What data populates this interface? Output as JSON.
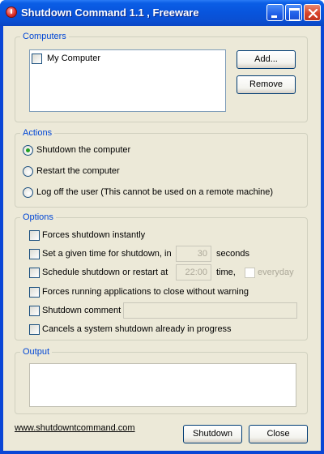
{
  "window": {
    "title": "Shutdown Command 1.1 , Freeware",
    "icon": "power-icon"
  },
  "computers": {
    "legend": "Computers",
    "items": [
      {
        "label": "My Computer",
        "checked": false
      }
    ],
    "add_label": "Add...",
    "remove_label": "Remove"
  },
  "actions": {
    "legend": "Actions",
    "options": [
      {
        "label": "Shutdown the computer",
        "checked": true
      },
      {
        "label": "Restart the computer",
        "checked": false
      },
      {
        "label": "Log off the user (This cannot be used on a remote machine)",
        "checked": false
      }
    ]
  },
  "options": {
    "legend": "Options",
    "force": "Forces shutdown instantly",
    "timed": "Set a given time for shutdown, in",
    "timed_value": "30",
    "timed_unit": "seconds",
    "schedule": "Schedule shutdown or restart at",
    "schedule_value": "22:00",
    "schedule_unit": "time,",
    "everyday": "everyday",
    "force_apps": "Forces running applications to close without warning",
    "comment": "Shutdown comment",
    "comment_value": "",
    "cancel": "Cancels a system shutdown already in progress"
  },
  "output": {
    "legend": "Output",
    "text": ""
  },
  "footer": {
    "link": "www.shutdowntcommand.com",
    "shutdown_label": "Shutdown",
    "close_label": "Close"
  },
  "colors": {
    "titlebar": "#0855dd",
    "face": "#ece9d8",
    "legend": "#0046d5"
  }
}
